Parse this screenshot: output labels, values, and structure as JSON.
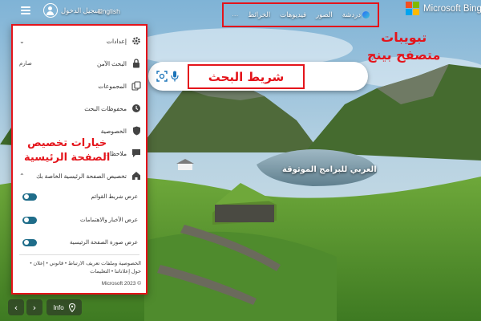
{
  "brand": {
    "name": "Microsoft Bing"
  },
  "tabs": [
    {
      "label": "دردشة",
      "icon": "bing-chat-icon"
    },
    {
      "label": "الصور"
    },
    {
      "label": "فيديوهات"
    },
    {
      "label": "الخرائط"
    },
    {
      "label": "···",
      "icon": "more-icon"
    }
  ],
  "header": {
    "language": "English",
    "signin": "تسجيل الدخول"
  },
  "annotations": {
    "tabs_line1": "تبويبات",
    "tabs_line2": "متصفح بينج",
    "search_bar": "شريط البحث",
    "customize_line1": "خيارات تخصيص",
    "customize_line2": "الصفحة الرئيسية",
    "watermark": "العربي للبرامج الموثوقة"
  },
  "settings": {
    "title": "إعدادات",
    "items": [
      {
        "label": "البحث الآمن",
        "value": "صارم",
        "icon": "lock-icon"
      },
      {
        "label": "المجموعات",
        "icon": "collections-icon"
      },
      {
        "label": "محفوظات البحث",
        "icon": "history-icon"
      },
      {
        "label": "الخصوصية",
        "icon": "shield-icon"
      },
      {
        "label": "ملاحظات",
        "icon": "feedback-icon"
      }
    ],
    "customize": {
      "title": "تخصيص الصفحة الرئيسية الخاصة بك",
      "icon": "home-icon",
      "toggles": [
        {
          "label": "عرض شريط القوائم",
          "on": true
        },
        {
          "label": "عرض الأخبار والاهتمامات",
          "on": true
        },
        {
          "label": "عرض صورة الصفحة الرئيسية",
          "on": true
        }
      ]
    },
    "footer_line1": "الخصوصية وملفات تعريف الارتباط • قانوني • إعلان •",
    "footer_line2": "حول إعلاناتنا • التعليمات",
    "copyright": "© Microsoft 2023"
  },
  "bottom": {
    "info": "Info",
    "prev_icon": "chevron-left-icon",
    "next_icon": "chevron-right-icon",
    "location_icon": "location-pin-icon"
  },
  "colors": {
    "annotation": "#e4141b",
    "toggle_on": "#1f6d8a",
    "ms_red": "#f25022",
    "ms_green": "#7fba00",
    "ms_blue": "#00a4ef",
    "ms_yellow": "#ffb900"
  }
}
